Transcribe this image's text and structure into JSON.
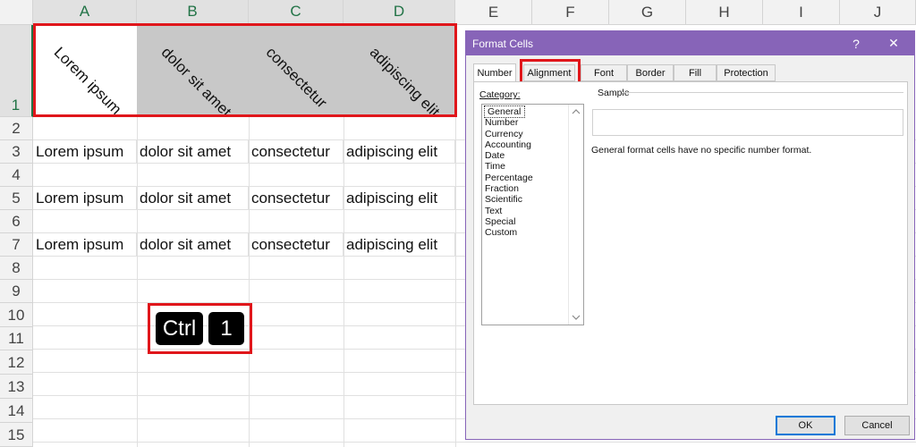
{
  "sheet": {
    "columns": [
      "A",
      "B",
      "C",
      "D",
      "E",
      "F",
      "G",
      "H",
      "I",
      "J"
    ],
    "rows": [
      "1",
      "2",
      "3",
      "4",
      "5",
      "6",
      "7",
      "8",
      "9",
      "10",
      "11",
      "12",
      "13",
      "14",
      "15"
    ],
    "header_row": [
      "Lorem ipsum",
      "dolor sit amet",
      "consectetur",
      "adipiscing elit"
    ],
    "row3": [
      "Lorem ipsum",
      "dolor sit amet",
      "consectetur",
      "adipiscing elit"
    ],
    "row5": [
      "Lorem ipsum",
      "dolor sit amet",
      "consectetur",
      "adipiscing elit"
    ],
    "row7": [
      "Lorem ipsum",
      "dolor sit amet",
      "consectetur",
      "adipiscing elit"
    ]
  },
  "shortcut": {
    "key1": "Ctrl",
    "key2": "1"
  },
  "dialog": {
    "title": "Format Cells",
    "help": "?",
    "close": "✕",
    "tabs": [
      "Number",
      "Alignment",
      "Font",
      "Border",
      "Fill",
      "Protection"
    ],
    "category_label": "Category:",
    "categories": [
      "General",
      "Number",
      "Currency",
      "Accounting",
      "Date",
      "Time",
      "Percentage",
      "Fraction",
      "Scientific",
      "Text",
      "Special",
      "Custom"
    ],
    "sample_label": "Sample",
    "description": "General format cells have no specific number format.",
    "ok": "OK",
    "cancel": "Cancel"
  },
  "colors": {
    "highlight": "#e0161b",
    "excel_green": "#217346",
    "dialog_accent": "#8764b8"
  }
}
